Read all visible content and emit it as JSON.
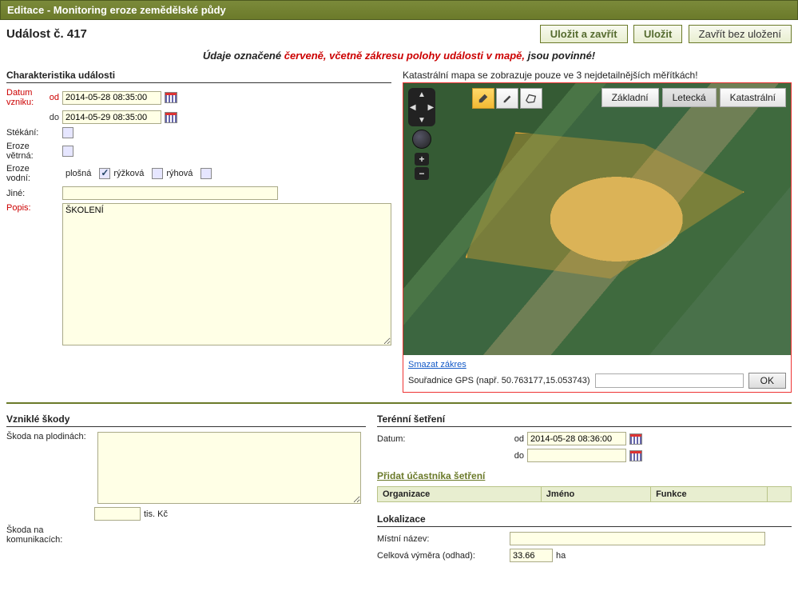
{
  "title_bar": "Editace - Monitoring eroze zemědělské půdy",
  "event_title": "Událost č. 417",
  "buttons": {
    "save_close": "Uložit a zavřít",
    "save": "Uložit",
    "close_no_save": "Zavřít bez uložení"
  },
  "warning": {
    "pre": "Údaje označené ",
    "mid": "červeně, včetně zákresu polohy události v mapě,",
    "post": " jsou povinné!"
  },
  "char": {
    "heading": "Charakteristika události",
    "datum_vzniku": "Datum vzniku:",
    "od": "od",
    "do": "do",
    "od_val": "2014-05-28 08:35:00",
    "do_val": "2014-05-29 08:35:00",
    "stekani": "Stékání:",
    "vetrna": "Eroze větrná:",
    "vodni": "Eroze vodní:",
    "plosna": "plošná",
    "ryzkova": "rýžková",
    "ryhova": "rýhová",
    "jine": "Jiné:",
    "popis": "Popis:",
    "popis_val": "ŠKOLENÍ"
  },
  "map": {
    "note": "Katastrální mapa se zobrazuje pouze ve 3 nejdetailnějších měřítkách!",
    "layer_basic": "Základní",
    "layer_aerial": "Letecká",
    "layer_cadastral": "Katastrální",
    "delete_link": "Smazat zákres",
    "gps_label": "Souřadnice GPS (např. 50.763177,15.053743)",
    "ok": "OK"
  },
  "damages": {
    "heading": "Vzniklé škody",
    "crops": "Škoda na plodinách:",
    "tis_kc": "tis. Kč",
    "comm": "Škoda na komunikacích:"
  },
  "survey": {
    "heading": "Terénní šetření",
    "datum": "Datum:",
    "od": "od",
    "do": "do",
    "od_val": "2014-05-28 08:36:00",
    "do_val": "",
    "add_participant": "Přidat účastníka šetření",
    "th_org": "Organizace",
    "th_name": "Jméno",
    "th_func": "Funkce"
  },
  "loc": {
    "heading": "Lokalizace",
    "name": "Místní název:",
    "area": "Celková výměra (odhad):",
    "area_val": "33.66",
    "ha": "ha"
  }
}
